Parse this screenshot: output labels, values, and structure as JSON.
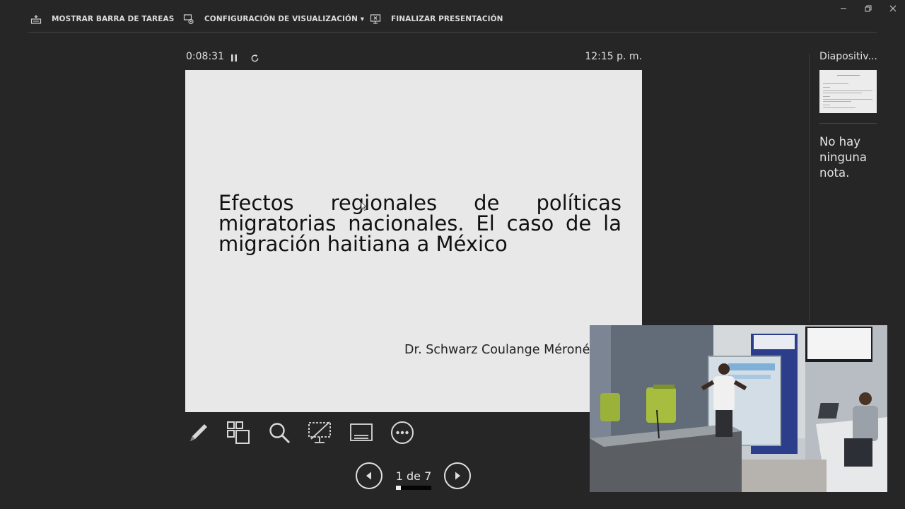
{
  "toolbar": {
    "taskbar_label": "MOSTRAR BARRA DE TAREAS",
    "display_settings_label": "CONFIGURACIÓN DE VISUALIZACIÓN ▾",
    "end_show_label": "FINALIZAR PRESENTACIÓN"
  },
  "window_controls": {
    "minimize": "—",
    "restore": "❐",
    "close": "✕"
  },
  "timer": {
    "elapsed": "0:08:31"
  },
  "clock": {
    "time": "12:15 p. m."
  },
  "slide": {
    "title": "Efectos regionales de políticas migratorias nacionales. El caso de la migración haitiana a México",
    "author": "Dr. Schwarz Coulange Méroné"
  },
  "sidebar": {
    "heading": "Diapositiv...",
    "notes": "No hay ninguna nota."
  },
  "navigation": {
    "current": 1,
    "total": 7,
    "page_label": "1 de 7",
    "progress": 0.14
  },
  "colors": {
    "background": "#262626",
    "slide_bg": "#e8e8e8",
    "text": "#e0e0e0",
    "chair_green": "#9bb23a"
  }
}
